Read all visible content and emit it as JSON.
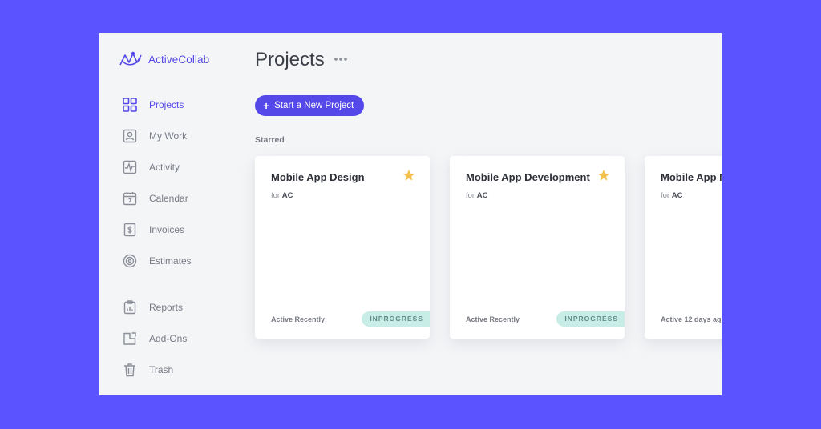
{
  "brand": {
    "name": "ActiveCollab",
    "color": "#5548e8"
  },
  "sidebar": {
    "items": [
      {
        "label": "Projects",
        "icon": "grid-icon",
        "active": true
      },
      {
        "label": "My Work",
        "icon": "person-icon"
      },
      {
        "label": "Activity",
        "icon": "activity-icon"
      },
      {
        "label": "Calendar",
        "icon": "calendar-icon"
      },
      {
        "label": "Invoices",
        "icon": "dollar-icon"
      },
      {
        "label": "Estimates",
        "icon": "target-icon"
      },
      {
        "label": "Reports",
        "icon": "clipboard-chart-icon"
      },
      {
        "label": "Add-Ons",
        "icon": "addon-icon"
      },
      {
        "label": "Trash",
        "icon": "trash-icon"
      }
    ]
  },
  "main": {
    "title": "Projects",
    "new_project_label": "Start a New Project",
    "starred_label": "Starred",
    "projects": [
      {
        "title": "Mobile App Design",
        "client_prefix": "for",
        "client": "AC",
        "starred": true,
        "activity": "Active Recently",
        "status": "INPROGRESS"
      },
      {
        "title": "Mobile App Development",
        "client_prefix": "for",
        "client": "AC",
        "starred": true,
        "activity": "Active Recently",
        "status": "INPROGRESS"
      },
      {
        "title": "Mobile App M",
        "client_prefix": "for",
        "client": "AC",
        "starred": false,
        "activity": "Active 12 days ag",
        "status": ""
      }
    ]
  },
  "colors": {
    "background": "#5a53ff",
    "accent": "#5548e8",
    "star": "#f4c14e",
    "status_bg": "#c8ece6"
  }
}
